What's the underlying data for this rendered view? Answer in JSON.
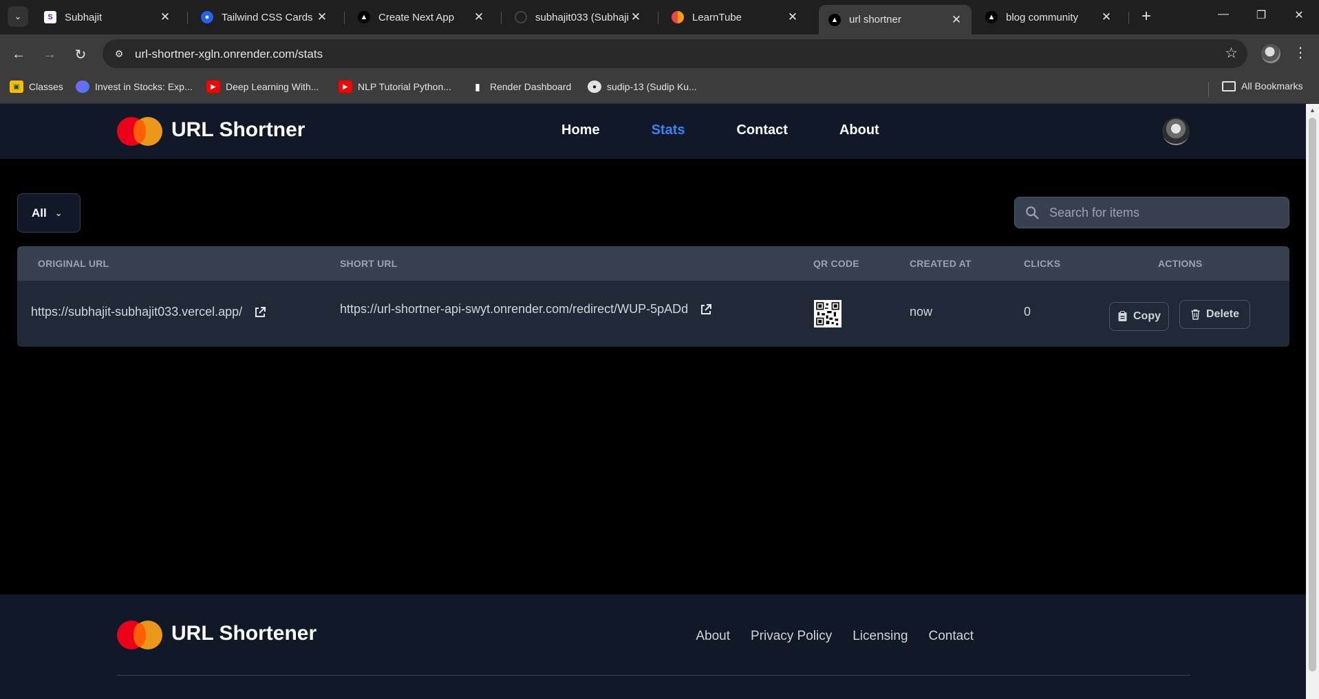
{
  "browser": {
    "tabs": [
      {
        "title": "Subhajit",
        "favicon": "subhajit-s-favicon",
        "color": "#ffffff"
      },
      {
        "title": "Tailwind CSS Cards -",
        "favicon": "tailwind-favicon",
        "color": "#2563eb"
      },
      {
        "title": "Create Next App",
        "favicon": "vercel-triangle-favicon",
        "color": "#ffffff"
      },
      {
        "title": "subhajit033 (Subhajit",
        "favicon": "github-favicon",
        "color": "#444444"
      },
      {
        "title": "LearnTube",
        "favicon": "learntube-favicon",
        "color": "#f97316"
      },
      {
        "title": "url shortner",
        "favicon": "vercel-triangle-favicon",
        "color": "#ffffff",
        "active": true
      },
      {
        "title": "blog community",
        "favicon": "vercel-triangle-favicon",
        "color": "#ffffff"
      }
    ],
    "url": "url-shortner-xgln.onrender.com/stats",
    "bookmarks": [
      {
        "label": "Classes",
        "icon": "classroom-icon"
      },
      {
        "label": "Invest in Stocks: Exp...",
        "icon": "globe-icon"
      },
      {
        "label": "Deep Learning With...",
        "icon": "youtube-icon"
      },
      {
        "label": "NLP Tutorial Python...",
        "icon": "youtube-icon"
      },
      {
        "label": "Render Dashboard",
        "icon": "render-icon"
      },
      {
        "label": "sudip-13 (Sudip Ku...",
        "icon": "github-icon"
      }
    ],
    "all_bookmarks": "All Bookmarks"
  },
  "site": {
    "brand": "URL Shortner",
    "nav": [
      {
        "label": "Home",
        "active": false
      },
      {
        "label": "Stats",
        "active": true
      },
      {
        "label": "Contact",
        "active": false
      },
      {
        "label": "About",
        "active": false
      }
    ],
    "accent": "#3b82f6"
  },
  "filter": {
    "selected": "All"
  },
  "search": {
    "placeholder": "Search for items",
    "value": ""
  },
  "table": {
    "headers": [
      "Original URL",
      "Short URL",
      "QR Code",
      "Created At",
      "Clicks",
      "Actions"
    ],
    "rows": [
      {
        "original_url": "https://subhajit-subhajit033.vercel.app/",
        "short_url": "https://url-shortner-api-swyt.onrender.com/redirect/WUP-5pADd",
        "created_at": "now",
        "clicks": "0",
        "copy_label": "Copy",
        "delete_label": "Delete"
      }
    ]
  },
  "footer": {
    "brand": "URL Shortener",
    "links": [
      "About",
      "Privacy Policy",
      "Licensing",
      "Contact"
    ]
  }
}
